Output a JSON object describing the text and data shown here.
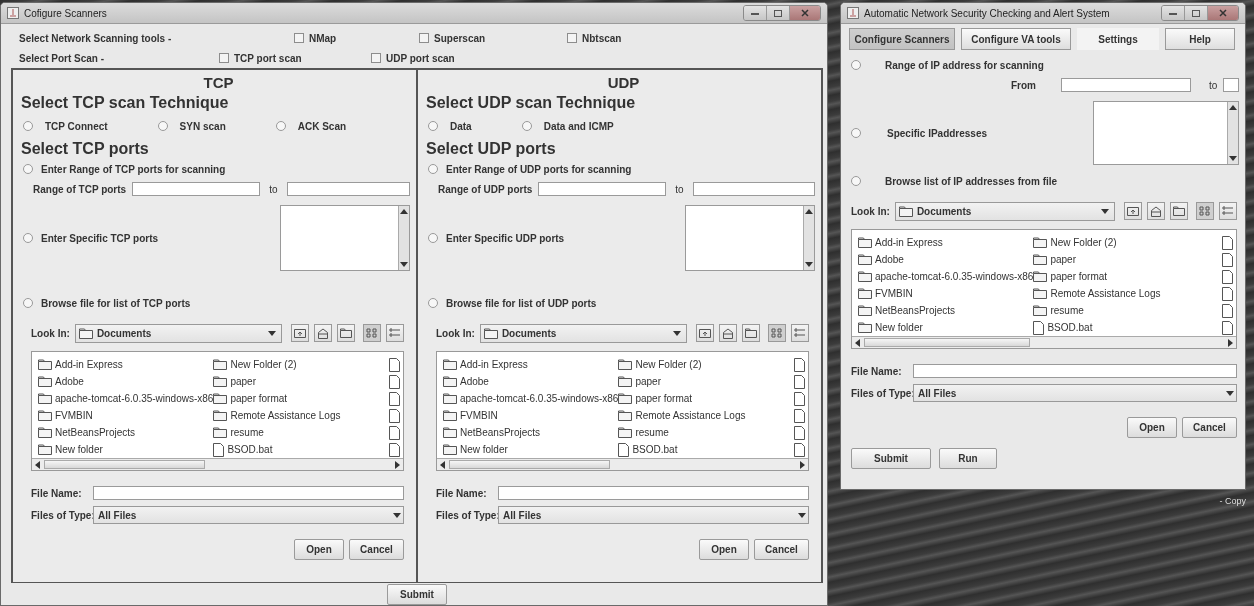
{
  "left_window": {
    "title": "Cofigure Scanners",
    "tool_row": {
      "label": "Select Network Scanning tools -",
      "options": [
        {
          "label": "NMap",
          "checked": false
        },
        {
          "label": "Superscan",
          "checked": false
        },
        {
          "label": "Nbtscan",
          "checked": false
        }
      ]
    },
    "port_row": {
      "label": "Select Port Scan  -",
      "options": [
        {
          "label": "TCP port scan",
          "checked": false
        },
        {
          "label": "UDP port scan",
          "checked": false
        }
      ]
    },
    "panels": [
      {
        "heading": "TCP",
        "technique_title": "Select TCP scan Technique",
        "techniques": [
          {
            "label": "TCP Connect",
            "selected": false
          },
          {
            "label": "SYN scan",
            "selected": false
          },
          {
            "label": "ACK Scan",
            "selected": false
          }
        ],
        "ports_title": "Select TCP ports",
        "range_option": {
          "label": "Enter Range of TCP ports for scanning",
          "selected": false
        },
        "range_label": "Range of TCP ports",
        "to_label": "to",
        "specific_option": {
          "label": "Enter Specific TCP ports",
          "selected": false
        },
        "browse_option": {
          "label": "Browse file for list of TCP ports",
          "selected": false
        },
        "file_chooser": {
          "look_in_label": "Look In:",
          "folder": "Documents",
          "items": [
            {
              "name": "Add-in Express",
              "kind": "folder"
            },
            {
              "name": "Adobe",
              "kind": "folder"
            },
            {
              "name": "apache-tomcat-6.0.35-windows-x86",
              "kind": "folder"
            },
            {
              "name": "FVMBIN",
              "kind": "folder"
            },
            {
              "name": "NetBeansProjects",
              "kind": "folder"
            },
            {
              "name": "New folder",
              "kind": "folder"
            },
            {
              "name": "New Folder (2)",
              "kind": "folder"
            },
            {
              "name": "paper",
              "kind": "folder"
            },
            {
              "name": "paper format",
              "kind": "folder"
            },
            {
              "name": "Remote Assistance Logs",
              "kind": "folder"
            },
            {
              "name": "resume",
              "kind": "folder"
            },
            {
              "name": "BSOD.bat",
              "kind": "file"
            }
          ],
          "file_name_label": "File Name:",
          "file_type_label": "Files of Type:",
          "file_type": "All Files",
          "buttons": [
            "Open",
            "Cancel"
          ]
        }
      },
      {
        "heading": "UDP",
        "technique_title": "Select UDP scan Technique",
        "techniques": [
          {
            "label": "Data",
            "selected": false
          },
          {
            "label": "Data and ICMP",
            "selected": false
          }
        ],
        "ports_title": "Select UDP ports",
        "range_option": {
          "label": "Enter Range of UDP ports for scanning",
          "selected": false
        },
        "range_label": "Range of UDP ports",
        "to_label": "to",
        "specific_option": {
          "label": "Enter Specific UDP ports",
          "selected": false
        },
        "browse_option": {
          "label": "Browse file for list of UDP ports",
          "selected": false
        },
        "file_chooser": {
          "look_in_label": "Look In:",
          "folder": "Documents",
          "items": [
            {
              "name": "Add-in Express",
              "kind": "folder"
            },
            {
              "name": "Adobe",
              "kind": "folder"
            },
            {
              "name": "apache-tomcat-6.0.35-windows-x86",
              "kind": "folder"
            },
            {
              "name": "FVMBIN",
              "kind": "folder"
            },
            {
              "name": "NetBeansProjects",
              "kind": "folder"
            },
            {
              "name": "New folder",
              "kind": "folder"
            },
            {
              "name": "New Folder (2)",
              "kind": "folder"
            },
            {
              "name": "paper",
              "kind": "folder"
            },
            {
              "name": "paper format",
              "kind": "folder"
            },
            {
              "name": "Remote Assistance Logs",
              "kind": "folder"
            },
            {
              "name": "resume",
              "kind": "folder"
            },
            {
              "name": "BSOD.bat",
              "kind": "file"
            }
          ],
          "file_name_label": "File Name:",
          "file_type_label": "Files of Type:",
          "file_type": "All Files",
          "buttons": [
            "Open",
            "Cancel"
          ]
        }
      }
    ],
    "submit": "Submit"
  },
  "right_window": {
    "title": "Automatic Network Security Checking and Alert System",
    "tabs": [
      {
        "label": "Configure Scanners",
        "selected": true,
        "highlighted": false
      },
      {
        "label": "Configure VA tools",
        "selected": false,
        "highlighted": false
      },
      {
        "label": "Settings",
        "selected": false,
        "highlighted": true
      },
      {
        "label": "Help",
        "selected": false,
        "highlighted": false
      }
    ],
    "range_option": {
      "label": "Range of IP address for scanning",
      "selected": false
    },
    "from_label": "From",
    "to_label": "to",
    "specific_option": {
      "label": "Specific IPaddresses",
      "selected": false
    },
    "browse_option": {
      "label": "Browse list of IP addresses from file",
      "selected": false
    },
    "file_chooser": {
      "look_in_label": "Look In:",
      "folder": "Documents",
      "items": [
        {
          "name": "Add-in Express",
          "kind": "folder"
        },
        {
          "name": "Adobe",
          "kind": "folder"
        },
        {
          "name": "apache-tomcat-6.0.35-windows-x86",
          "kind": "folder"
        },
        {
          "name": "FVMBIN",
          "kind": "folder"
        },
        {
          "name": "NetBeansProjects",
          "kind": "folder"
        },
        {
          "name": "New folder",
          "kind": "folder"
        },
        {
          "name": "New Folder (2)",
          "kind": "folder"
        },
        {
          "name": "paper",
          "kind": "folder"
        },
        {
          "name": "paper format",
          "kind": "folder"
        },
        {
          "name": "Remote Assistance Logs",
          "kind": "folder"
        },
        {
          "name": "resume",
          "kind": "folder"
        },
        {
          "name": "BSOD.bat",
          "kind": "file"
        }
      ],
      "file_name_label": "File Name:",
      "file_type_label": "Files of Type:",
      "file_type": "All Files",
      "buttons": [
        "Open",
        "Cancel"
      ]
    },
    "buttons": [
      "Submit",
      "Run"
    ]
  },
  "desktop": {
    "icon_label": "- Copy"
  }
}
